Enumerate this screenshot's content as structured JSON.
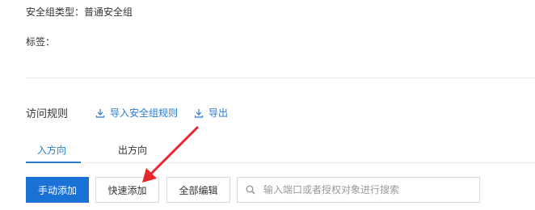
{
  "info": {
    "sg_type_label": "安全组类型：",
    "sg_type_value": "普通安全组",
    "tags_label": "标签："
  },
  "rules": {
    "title": "访问规则",
    "import_link": "导入安全组规则",
    "export_link": "导出"
  },
  "tabs": [
    {
      "label": "入方向",
      "active": true
    },
    {
      "label": "出方向",
      "active": false
    }
  ],
  "toolbar": {
    "manual_add": "手动添加",
    "quick_add": "快速添加",
    "edit_all": "全部编辑",
    "search_placeholder": "输入端口或者授权对象进行搜索"
  },
  "colors": {
    "accent": "#1a72d6",
    "link": "#2a7ad0",
    "annotation_arrow": "#e8262c"
  }
}
